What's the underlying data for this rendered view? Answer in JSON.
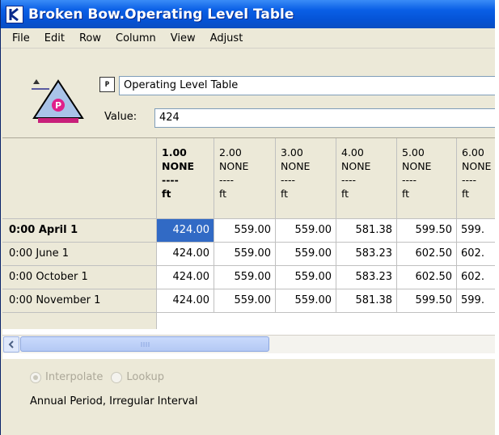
{
  "window": {
    "title": "Broken Bow.Operating Level Table"
  },
  "menu": [
    "File",
    "Edit",
    "Row",
    "Column",
    "View",
    "Adjust"
  ],
  "header": {
    "object_icon_letter": "P",
    "table_icon_text": "P",
    "name": "Operating Level Table",
    "value_label": "Value:",
    "value": "424"
  },
  "table": {
    "columns": [
      {
        "index": "1.00",
        "type": "NONE",
        "sep": "----",
        "unit": "ft"
      },
      {
        "index": "2.00",
        "type": "NONE",
        "sep": "----",
        "unit": "ft"
      },
      {
        "index": "3.00",
        "type": "NONE",
        "sep": "----",
        "unit": "ft"
      },
      {
        "index": "4.00",
        "type": "NONE",
        "sep": "----",
        "unit": "ft"
      },
      {
        "index": "5.00",
        "type": "NONE",
        "sep": "----",
        "unit": "ft"
      },
      {
        "index": "6.00",
        "type": "NONE",
        "sep": "----",
        "unit": "ft"
      }
    ],
    "rows": [
      {
        "label": "0:00 April 1",
        "values": [
          "424.00",
          "559.00",
          "559.00",
          "581.38",
          "599.50",
          "599."
        ]
      },
      {
        "label": "0:00 June 1",
        "values": [
          "424.00",
          "559.00",
          "559.00",
          "583.23",
          "602.50",
          "602."
        ]
      },
      {
        "label": "0:00 October 1",
        "values": [
          "424.00",
          "559.00",
          "559.00",
          "583.23",
          "602.50",
          "602."
        ]
      },
      {
        "label": "0:00 November 1",
        "values": [
          "424.00",
          "559.00",
          "559.00",
          "581.38",
          "599.50",
          "599."
        ]
      }
    ]
  },
  "options": {
    "interpolate": "Interpolate",
    "lookup": "Lookup",
    "selected": "interpolate"
  },
  "status": "Annual Period, Irregular Interval"
}
